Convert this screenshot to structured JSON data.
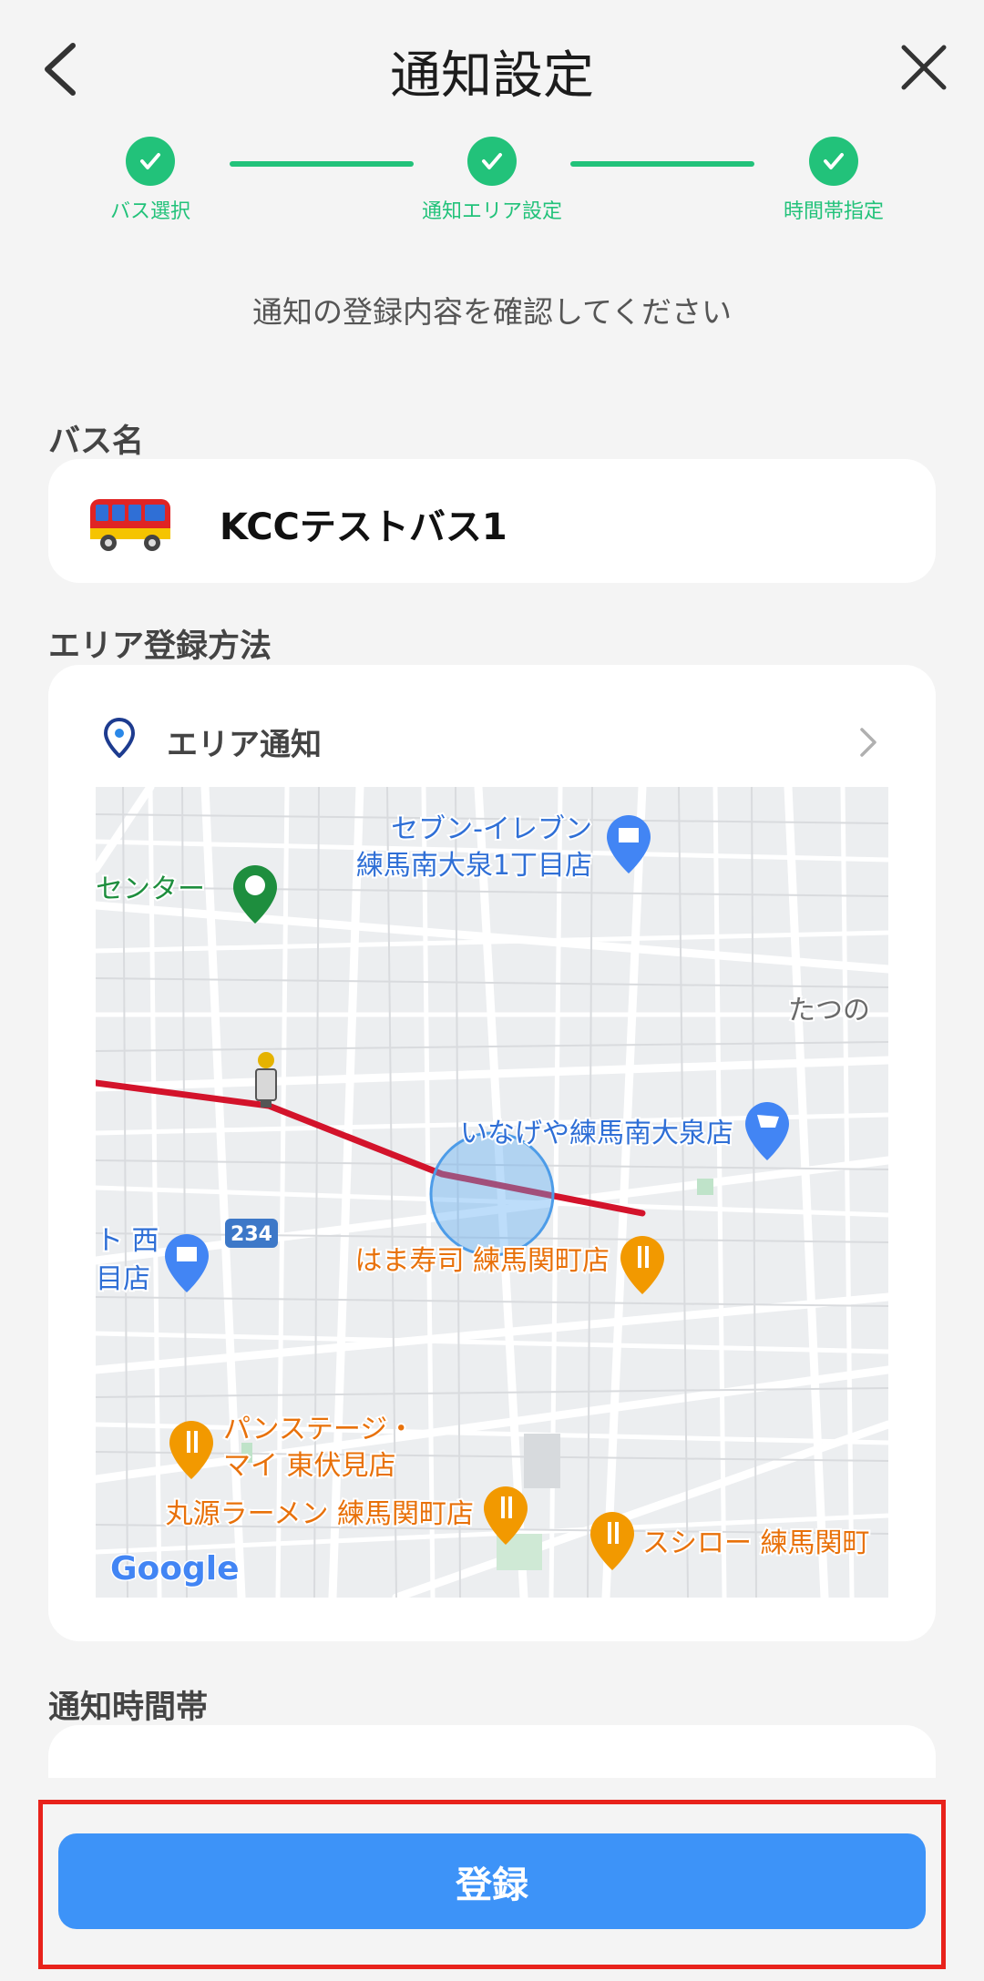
{
  "header": {
    "title": "通知設定"
  },
  "steps": [
    {
      "label": "バス選択"
    },
    {
      "label": "通知エリア設定"
    },
    {
      "label": "時間帯指定"
    }
  ],
  "intro": "通知の登録内容を確認してください",
  "bus_section": {
    "label": "バス名",
    "bus_name": "KCCテストバス1"
  },
  "area_section": {
    "label": "エリア登録方法",
    "method": "エリア通知"
  },
  "map": {
    "labels": {
      "seven": "セブン-イレブン",
      "seven2": "練馬南大泉1丁目店",
      "center": "センター",
      "tatsuno": "たつの",
      "inageya": "いなげや練馬南大泉店",
      "nishi1": "ト 西",
      "nishi2": "目店",
      "route": "234",
      "hama": "はま寿司 練馬関町店",
      "pan1": "パンステージ・",
      "pan2": "マイ 東伏見店",
      "marugen": "丸源ラーメン 練馬関町店",
      "sushiro": "スシロー 練馬関町",
      "google": "Google"
    },
    "colors": {
      "route_line": "#d3132b",
      "circle": "#5aa9f2",
      "poi_blue": "#4285f4",
      "poi_orange": "#f29900",
      "poi_green": "#1e8e3e"
    }
  },
  "time_section": {
    "label": "通知時間帯"
  },
  "footer": {
    "register_label": "登録"
  },
  "colors": {
    "accent_green": "#22c27a",
    "button_blue": "#3d93f8",
    "highlight_red": "#e8221b"
  }
}
